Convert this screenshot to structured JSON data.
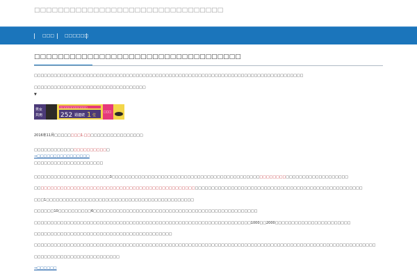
{
  "site": {
    "title": "□□□□□□□□□□□□□□□□□□□□□□□□□□□□□□□□"
  },
  "nav": {
    "items": [
      {
        "label": "□□□"
      },
      {
        "label": "□□□□□□"
      }
    ]
  },
  "article": {
    "title": "□□□□□□□□□□□□□□□□□□□□□□□□□□□□□□□□□□□",
    "p1": "□□□□□□□□□□□□□□□□□□□□□□□□□□□□□□□□□□□□□□□□□□□□□□□□□□□□□□□□□□□□□□□□□□□□□□□□□□□□□□□□□□",
    "p2": "□□□□□□□□□□□□□□□□□□□□□□□□□□□□□□□□□□",
    "arrow": "▼",
    "banner": {
      "text_a": "男女",
      "text_b": "共用",
      "tagline": "□□□□□□□□□□□□",
      "rank_count": "252",
      "rank_label": "週連続",
      "rank_first": "1",
      "rank_suffix": "位",
      "brand": "□□□",
      "colors": {
        "bg": "#f3d64a",
        "accent": "#e6397a",
        "dark": "#2d2a26",
        "purple": "#4b3a78"
      }
    },
    "date_line": {
      "prefix": "2016年11月□□□□□",
      "highlight": "□□□1.□□",
      "suffix": "□□□□□□□□□□□□□□□□"
    },
    "line5": {
      "text": "□□□□□□□□□□□□",
      "highlight": "□□□□□□□□□□",
      "end": "□"
    },
    "link1": "⇒□□□□□□□□□□□□□□□□",
    "line6": "□□□□□□□□□□□□□□□□□□□□□",
    "para7": {
      "a": "□□□□□□□□□□□□□□□□□□□□□□□3□□□□□□□□□□□□□□□□□□□□□□□□□□□□□□□□□□□□□□□□□□□□□",
      "highlight": "□□□□□□□□",
      "b": "□□□□□□□□□□□□□□□□□□□"
    },
    "para8": {
      "a": "□□",
      "highlight": "□□□□□□□□□□□□□□□□□□□□□□□□□□□□□□□□□□□□□□□□□□□□□□□",
      "b": "□□□□□□□□□□□□□□□□□□□□□□□□□□□□□□□□□□□□□□□□□□□□□□□□□□□"
    },
    "para9": "□□□1□□□□□□□□□□□□□□□□□□□□□□□□□□□□□□□□□□□□□□□□□□□□□",
    "para10": "□□□□□□10□□□□□□□□□□6□□□□□□□□□□□□□□□□□□□□□□□□□□□□□□□□□□□□□□□□□□□□□□□□□□",
    "para11": "□□□□□□□□□□□□□□□□□□□□□□□□□□□□□□□□□□□□□□□□□□□□□□□□□□□□□□□□□□□□□□□□□□1000□□2000□□□□□□□□□□□□□□□□□□□□□□□",
    "para12": "□□□□□□□□□□□□□□□□□□□□□□□□□□□□□□□□□□□□□□□□□□",
    "para13": "□□□□□□□□□□□□□□□□□□□□□□□□□□□□□□□□□□□□□□□□□□□□□□□□□□□□□□□□□□□□□□□□□□□□□□□□□□□□□□□□□□□□□□□□□□□□□□□□□□□□□□□□",
    "para14": "□□□□□□□□□□□□□□□□□□□□□□□□□□",
    "link2": "⇒□□□□□□"
  }
}
